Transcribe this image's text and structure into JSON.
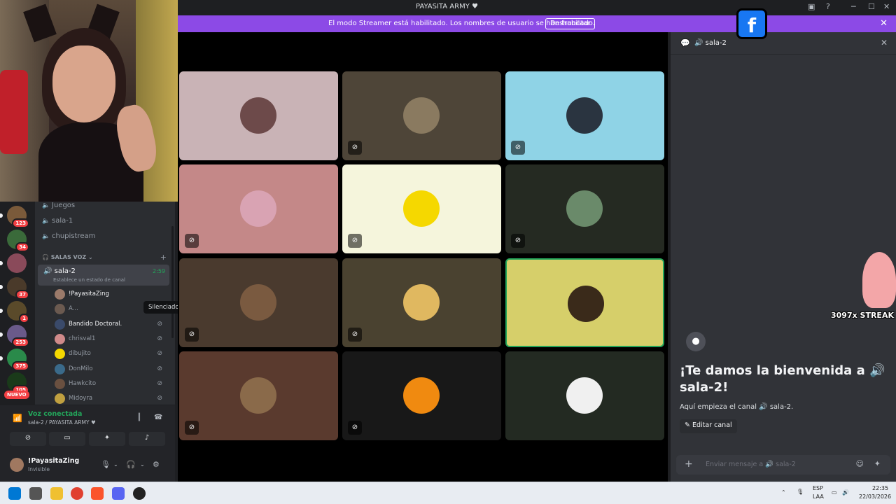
{
  "window": {
    "title": "PAYASITA ARMY ♥",
    "controls": [
      "─",
      "☐",
      "✕"
    ]
  },
  "banner": {
    "text": "El modo Streamer está habilitado. Los nombres de usuario se han truncado.",
    "button_label": "Deshabilitar",
    "close_glyph": "✕"
  },
  "servers": {
    "badges": [
      "123",
      "34",
      "37",
      "1",
      "253",
      "375",
      "105"
    ],
    "new_label": "NUEVO"
  },
  "channels": {
    "text_channels": [
      "Juegos",
      "sala-1",
      "chupistream"
    ],
    "category": "SALAS VOZ",
    "active": {
      "name": "sala-2",
      "time": "2:59",
      "status": "Establece un estado de canal"
    },
    "members": [
      {
        "name": "!PayasitaZing",
        "highlight": true,
        "color": "#9b7a6a"
      },
      {
        "name": "A...",
        "highlight": false,
        "color": "#6b5a50"
      },
      {
        "name": "Bandido Doctoral.",
        "highlight": true,
        "color": "#3a4a6a"
      },
      {
        "name": "chrisval1",
        "highlight": false,
        "color": "#d08a8a"
      },
      {
        "name": "dibujito",
        "highlight": false,
        "color": "#f5d800"
      },
      {
        "name": "DonMilo",
        "highlight": false,
        "color": "#3a6a8a"
      },
      {
        "name": "Hawkcito",
        "highlight": false,
        "color": "#6a5040"
      },
      {
        "name": "Midoyra",
        "highlight": false,
        "color": "#c0a040"
      }
    ],
    "tooltip": "Silenciado"
  },
  "voice": {
    "status": "Voz conectada",
    "location": "sala-2 / PAYASITA ARMY ♥"
  },
  "user": {
    "name": "!PayasitaZing",
    "status": "Invisible"
  },
  "tiles": [
    {
      "bg": "#c9b3b6",
      "av": "#6d4a4a",
      "muted": false,
      "speaking": false
    },
    {
      "bg": "#4e4538",
      "av": "#8a7a60",
      "muted": true,
      "speaking": false
    },
    {
      "bg": "#8fd3e6",
      "av": "#2a3440",
      "muted": true,
      "speaking": false
    },
    {
      "bg": "#c48888",
      "av": "#d9a3b3",
      "muted": true,
      "speaking": false
    },
    {
      "bg": "#f5f5dc",
      "av": "#f5d800",
      "muted": true,
      "speaking": false
    },
    {
      "bg": "#252a22",
      "av": "#6a8a6a",
      "muted": true,
      "speaking": false
    },
    {
      "bg": "#4a3a2e",
      "av": "#7a5a40",
      "muted": true,
      "speaking": false
    },
    {
      "bg": "#4a4230",
      "av": "#e0b860",
      "muted": true,
      "speaking": false
    },
    {
      "bg": "#d6cf6a",
      "av": "#3a2a1a",
      "muted": false,
      "speaking": true
    },
    {
      "bg": "#5a3a2e",
      "av": "#8a6a4a",
      "muted": true,
      "speaking": false
    },
    {
      "bg": "#181818",
      "av": "#f08a10",
      "muted": true,
      "speaking": false
    },
    {
      "bg": "#232a22",
      "av": "#f0f0f0",
      "muted": false,
      "speaking": false
    }
  ],
  "chat": {
    "channel": "sala-2",
    "welcome": "¡Te damos la bienvenida a 🔊 sala-2!",
    "subtitle": "Aquí empieza el canal 🔊 sala-2.",
    "edit_button": "Editar canal",
    "input_placeholder": "Enviar mensaje a 🔊 sala-2"
  },
  "overlay": {
    "streak": "3097x STREAK",
    "facebook": "f"
  },
  "taskbar": {
    "lang": "ESP",
    "lang2": "LAA",
    "time": "22:35",
    "date": "22/03/2026"
  }
}
